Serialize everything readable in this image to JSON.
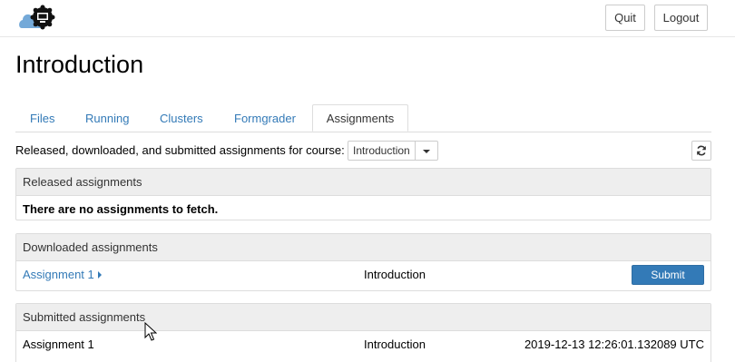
{
  "header": {
    "quit_label": "Quit",
    "logout_label": "Logout",
    "logo_icon": "jupyter-cloud-logo-icon"
  },
  "page": {
    "title": "Introduction"
  },
  "tabs": [
    {
      "label": "Files",
      "active": false
    },
    {
      "label": "Running",
      "active": false
    },
    {
      "label": "Clusters",
      "active": false
    },
    {
      "label": "Formgrader",
      "active": false
    },
    {
      "label": "Assignments",
      "active": true
    }
  ],
  "course_selector": {
    "label": "Released, downloaded, and submitted assignments for course:",
    "selected": "Introduction",
    "refresh_icon": "refresh-icon"
  },
  "released": {
    "heading": "Released assignments",
    "empty_message": "There are no assignments to fetch."
  },
  "downloaded": {
    "heading": "Downloaded assignments",
    "rows": [
      {
        "name": "Assignment 1",
        "course": "Introduction",
        "action": "Submit"
      }
    ]
  },
  "submitted": {
    "heading": "Submitted assignments",
    "rows": [
      {
        "name": "Assignment 1",
        "course": "Introduction",
        "timestamp": "2019-12-13 12:26:01.132089 UTC"
      }
    ]
  },
  "colors": {
    "link": "#337ab7",
    "primary_button": "#337ab7",
    "panel_heading_bg": "#eeeeee"
  }
}
